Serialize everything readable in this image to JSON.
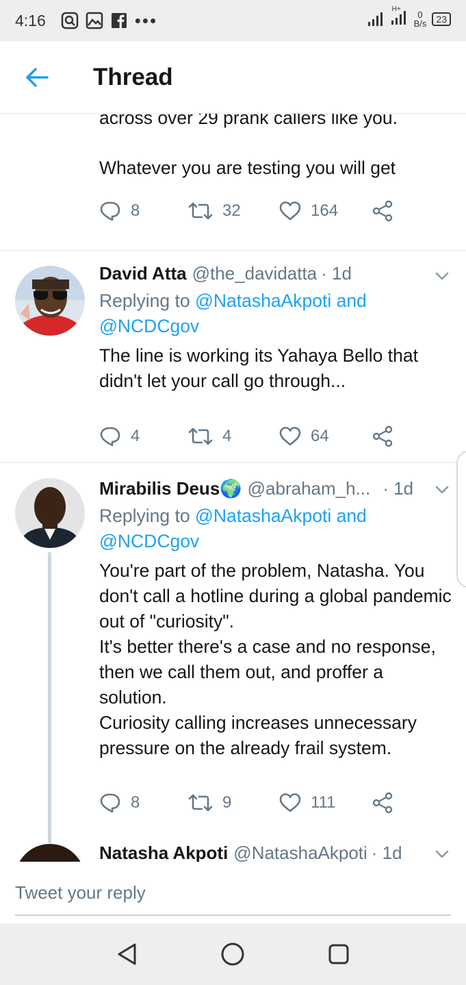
{
  "status_bar": {
    "time": "4:16",
    "net_speed_value": "0",
    "net_speed_unit": "B/s",
    "network_type": "H+",
    "battery": "23"
  },
  "header": {
    "title": "Thread"
  },
  "tweets": [
    {
      "text_partial_top": "across over 29 prank callers like you.",
      "text": "Whatever you are testing you will get",
      "replies": "8",
      "retweets": "32",
      "likes": "164"
    },
    {
      "name": "David Atta",
      "handle": "@the_davidatta",
      "time": "· 1d",
      "replying_prefix": "Replying to ",
      "replying_user1": "@NatashaAkpoti",
      "replying_and": " and",
      "replying_user2": "@NCDCgov",
      "text": "The line is working its Yahaya Bello that didn't let your call go through...",
      "replies": "4",
      "retweets": "4",
      "likes": "64"
    },
    {
      "name": "Mirabilis Deus🌍",
      "handle": "@abraham_h...",
      "time": "· 1d",
      "replying_prefix": "Replying to ",
      "replying_user1": "@NatashaAkpoti",
      "replying_and": " and",
      "replying_user2": "@NCDCgov",
      "text_lines": [
        "You're part of the problem, Natasha. You don't call a hotline during a global pandemic out of \"curiosity\".",
        "It's better there's a case and no response, then we call them out, and proffer a solution.",
        "Curiosity calling increases unnecessary pressure on the already frail system."
      ],
      "replies": "8",
      "retweets": "9",
      "likes": "111"
    },
    {
      "name": "Natasha Akpoti",
      "handle": "@NatashaAkpoti",
      "time": "· 1d"
    }
  ],
  "reply_bar": {
    "placeholder": "Tweet your reply"
  },
  "colors": {
    "accent": "#1da1f2",
    "text_primary": "#14171a",
    "text_secondary": "#657786",
    "divider": "#e1e8ed"
  },
  "icons": [
    "back-arrow-icon",
    "reply-icon",
    "retweet-icon",
    "like-icon",
    "share-icon",
    "chevron-down-icon",
    "nav-back-icon",
    "nav-home-icon",
    "nav-recents-icon"
  ]
}
